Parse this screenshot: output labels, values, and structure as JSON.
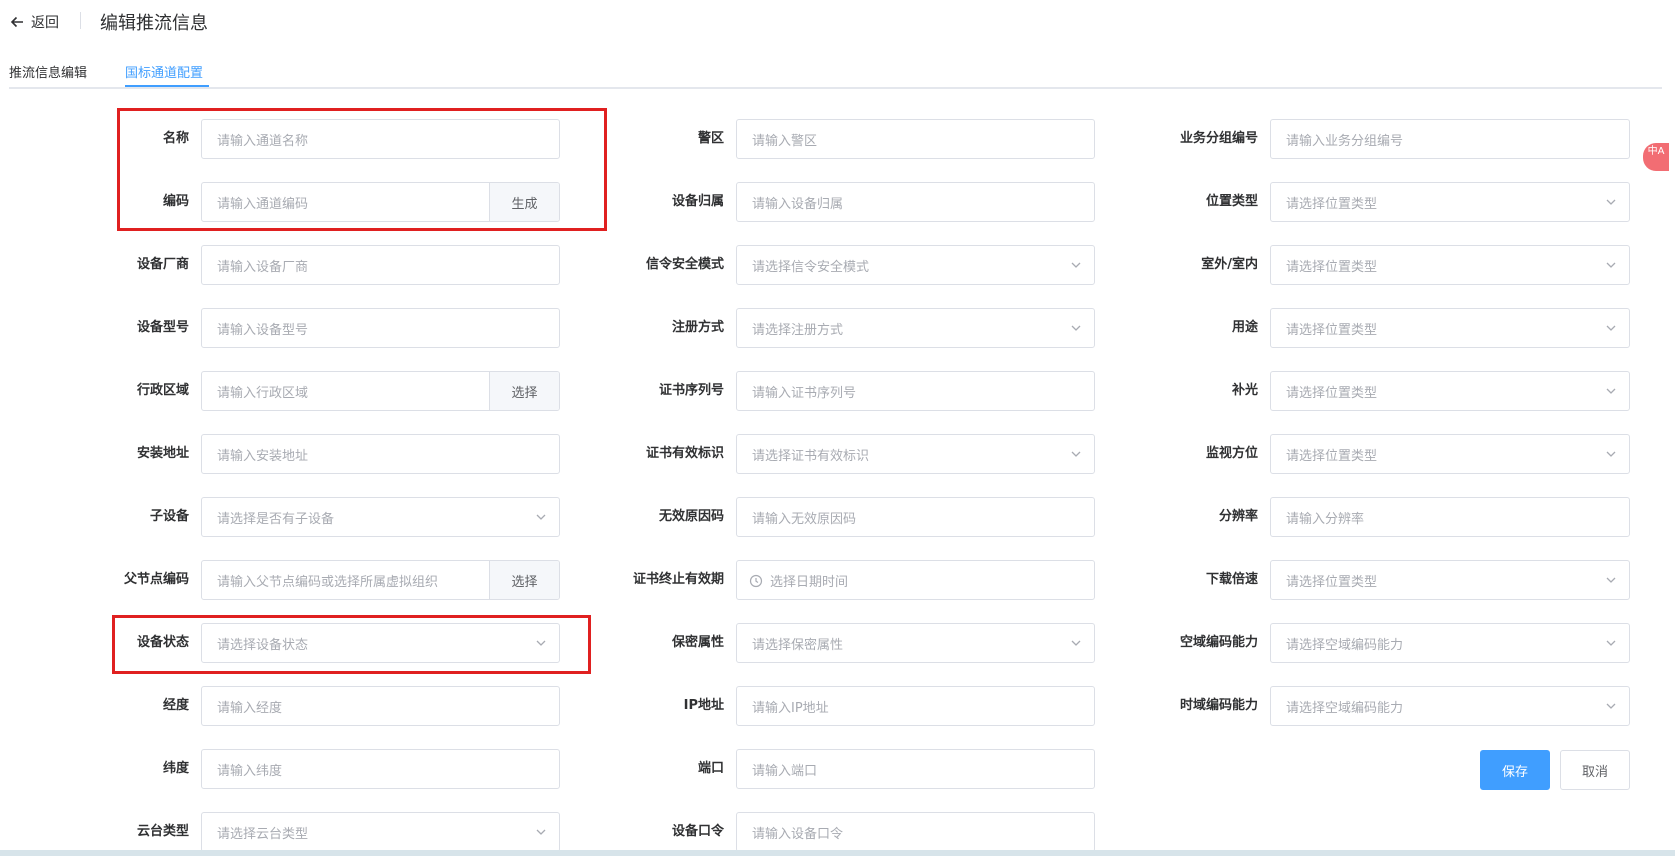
{
  "header": {
    "back_label": "返回",
    "title": "编辑推流信息"
  },
  "tabs": [
    {
      "label": "推流信息编辑",
      "active": false
    },
    {
      "label": "国标通道配置",
      "active": true
    }
  ],
  "form": {
    "col1": [
      {
        "label": "名称",
        "placeholder": "请输入通道名称",
        "type": "input"
      },
      {
        "label": "编码",
        "placeholder": "请输入通道编码",
        "type": "input-append",
        "append": "生成"
      },
      {
        "label": "设备厂商",
        "placeholder": "请输入设备厂商",
        "type": "input"
      },
      {
        "label": "设备型号",
        "placeholder": "请输入设备型号",
        "type": "input"
      },
      {
        "label": "行政区域",
        "placeholder": "请输入行政区域",
        "type": "input-append",
        "append": "选择"
      },
      {
        "label": "安装地址",
        "placeholder": "请输入安装地址",
        "type": "input"
      },
      {
        "label": "子设备",
        "placeholder": "请选择是否有子设备",
        "type": "select"
      },
      {
        "label": "父节点编码",
        "placeholder": "请输入父节点编码或选择所属虚拟组织",
        "type": "input-append",
        "append": "选择"
      },
      {
        "label": "设备状态",
        "placeholder": "请选择设备状态",
        "type": "select"
      },
      {
        "label": "经度",
        "placeholder": "请输入经度",
        "type": "input"
      },
      {
        "label": "纬度",
        "placeholder": "请输入纬度",
        "type": "input"
      },
      {
        "label": "云台类型",
        "placeholder": "请选择云台类型",
        "type": "select"
      }
    ],
    "col2": [
      {
        "label": "警区",
        "placeholder": "请输入警区",
        "type": "input"
      },
      {
        "label": "设备归属",
        "placeholder": "请输入设备归属",
        "type": "input"
      },
      {
        "label": "信令安全模式",
        "placeholder": "请选择信令安全模式",
        "type": "select"
      },
      {
        "label": "注册方式",
        "placeholder": "请选择注册方式",
        "type": "select"
      },
      {
        "label": "证书序列号",
        "placeholder": "请输入证书序列号",
        "type": "input"
      },
      {
        "label": "证书有效标识",
        "placeholder": "请选择证书有效标识",
        "type": "select"
      },
      {
        "label": "无效原因码",
        "placeholder": "请输入无效原因码",
        "type": "input"
      },
      {
        "label": "证书终止有效期",
        "placeholder": "选择日期时间",
        "type": "date"
      },
      {
        "label": "保密属性",
        "placeholder": "请选择保密属性",
        "type": "select"
      },
      {
        "label": "IP地址",
        "placeholder": "请输入IP地址",
        "type": "input"
      },
      {
        "label": "端口",
        "placeholder": "请输入端口",
        "type": "input"
      },
      {
        "label": "设备口令",
        "placeholder": "请输入设备口令",
        "type": "input"
      }
    ],
    "col3": [
      {
        "label": "业务分组编号",
        "placeholder": "请输入业务分组编号",
        "type": "input"
      },
      {
        "label": "位置类型",
        "placeholder": "请选择位置类型",
        "type": "select"
      },
      {
        "label": "室外/室内",
        "placeholder": "请选择位置类型",
        "type": "select"
      },
      {
        "label": "用途",
        "placeholder": "请选择位置类型",
        "type": "select"
      },
      {
        "label": "补光",
        "placeholder": "请选择位置类型",
        "type": "select"
      },
      {
        "label": "监视方位",
        "placeholder": "请选择位置类型",
        "type": "select"
      },
      {
        "label": "分辨率",
        "placeholder": "请输入分辨率",
        "type": "input"
      },
      {
        "label": "下载倍速",
        "placeholder": "请选择位置类型",
        "type": "select"
      },
      {
        "label": "空域编码能力",
        "placeholder": "请选择空域编码能力",
        "type": "select"
      },
      {
        "label": "时域编码能力",
        "placeholder": "请选择空域编码能力",
        "type": "select"
      }
    ]
  },
  "actions": {
    "save_label": "保存",
    "cancel_label": "取消"
  },
  "extension_badge": "中A",
  "colors": {
    "primary": "#409eff",
    "highlight_box": "#e02020",
    "border": "#dcdfe6",
    "placeholder": "#a8abb2"
  }
}
